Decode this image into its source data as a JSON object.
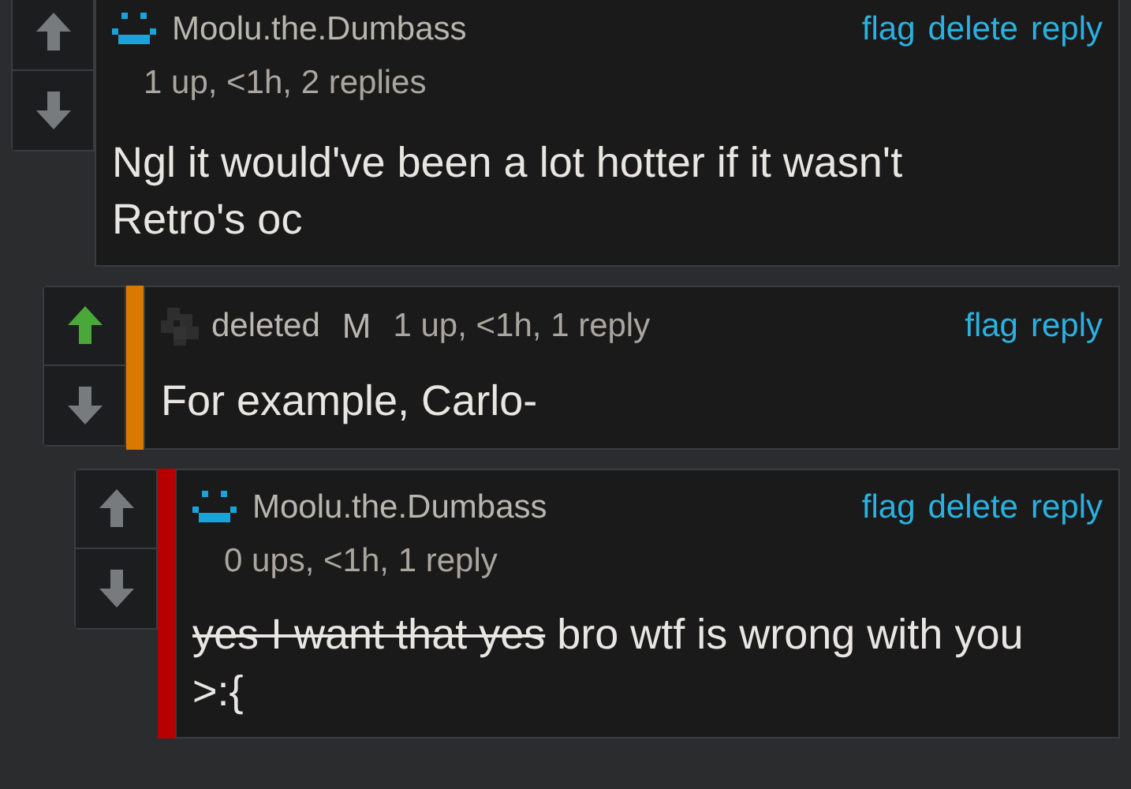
{
  "comments": [
    {
      "kind": "user",
      "username": "Moolu.the.Dumbass",
      "meta": "1 up, <1h, 2 replies",
      "upvoted": false,
      "actions": [
        "flag",
        "delete",
        "reply"
      ],
      "text": [
        {
          "text": "Ngl it would've been a lot hotter if it wasn't Retro's oc",
          "struck": false
        }
      ],
      "children": [
        {
          "kind": "deleted",
          "username": "deleted",
          "badge": "M",
          "meta": "1 up, <1h, 1 reply",
          "color": "#d97a00",
          "upvoted": true,
          "actions": [
            "flag",
            "reply"
          ],
          "text": [
            {
              "text": "For example, Carlo-",
              "struck": false
            }
          ],
          "children": [
            {
              "kind": "user",
              "username": "Moolu.the.Dumbass",
              "meta": "0 ups, <1h, 1 reply",
              "color": "#b50000",
              "upvoted": false,
              "actions": [
                "flag",
                "delete",
                "reply"
              ],
              "text": [
                {
                  "text": "yes I want that yes",
                  "struck": true
                },
                {
                  "text": " bro wtf is wrong with you >:{",
                  "struck": false
                }
              ]
            }
          ]
        }
      ]
    }
  ]
}
